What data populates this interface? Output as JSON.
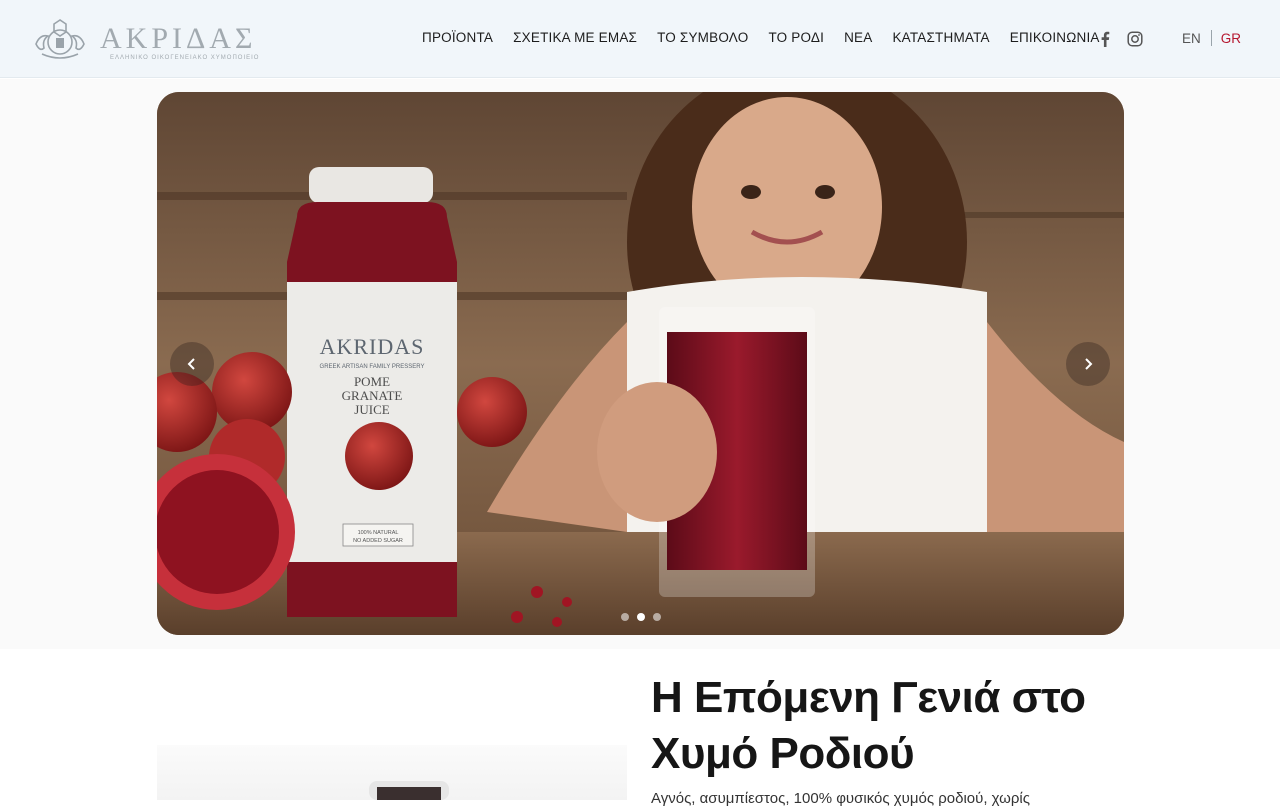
{
  "header": {
    "logo": {
      "wordmark": "ΑΚΡΙΔΑΣ",
      "tagline": "ΕΛΛΗΝΙΚΟ ΟΙΚΟΓΕΝΕΙΑΚΟ ΧΥΜΟΠΟΙΕΙΟ",
      "color": "#9aa3aa"
    },
    "nav": [
      {
        "label": "ΠΡΟΪΟΝΤΑ"
      },
      {
        "label": "ΣΧΕΤΙΚΑ ΜΕ ΕΜΑΣ"
      },
      {
        "label": "ΤΟ ΣΥΜΒΟΛΟ"
      },
      {
        "label": "ΤΟ ΡΟΔΙ"
      },
      {
        "label": "ΝΕΑ"
      },
      {
        "label": "ΚΑΤΑΣΤΗΜΑΤΑ"
      },
      {
        "label": "ΕΠΙΚΟΙΝΩΝΙΑ"
      }
    ],
    "social": [
      "facebook-icon",
      "instagram-icon"
    ],
    "languages": {
      "en": "EN",
      "gr": "GR",
      "active": "GR",
      "active_color": "#b5172f"
    }
  },
  "hero": {
    "bottle_label": {
      "brand": "AKRIDAS",
      "subtitle": "GREEK ARTISAN FAMILY PRESSERY",
      "product_line1": "POME",
      "product_line2": "GRANATE",
      "product_line3": "JUICE",
      "badge_line1": "100% NATURAL",
      "badge_line2": "NO ADDED SUGAR"
    },
    "slides_count": 3,
    "active_slide": 2
  },
  "section": {
    "heading_line1": "Η Επόμενη Γενιά στο",
    "heading_line2": "Χυμό Ροδιού",
    "body": "Αγνός, ασυμπίεστος, 100% φυσικός χυμός ροδιού, χωρίς"
  }
}
